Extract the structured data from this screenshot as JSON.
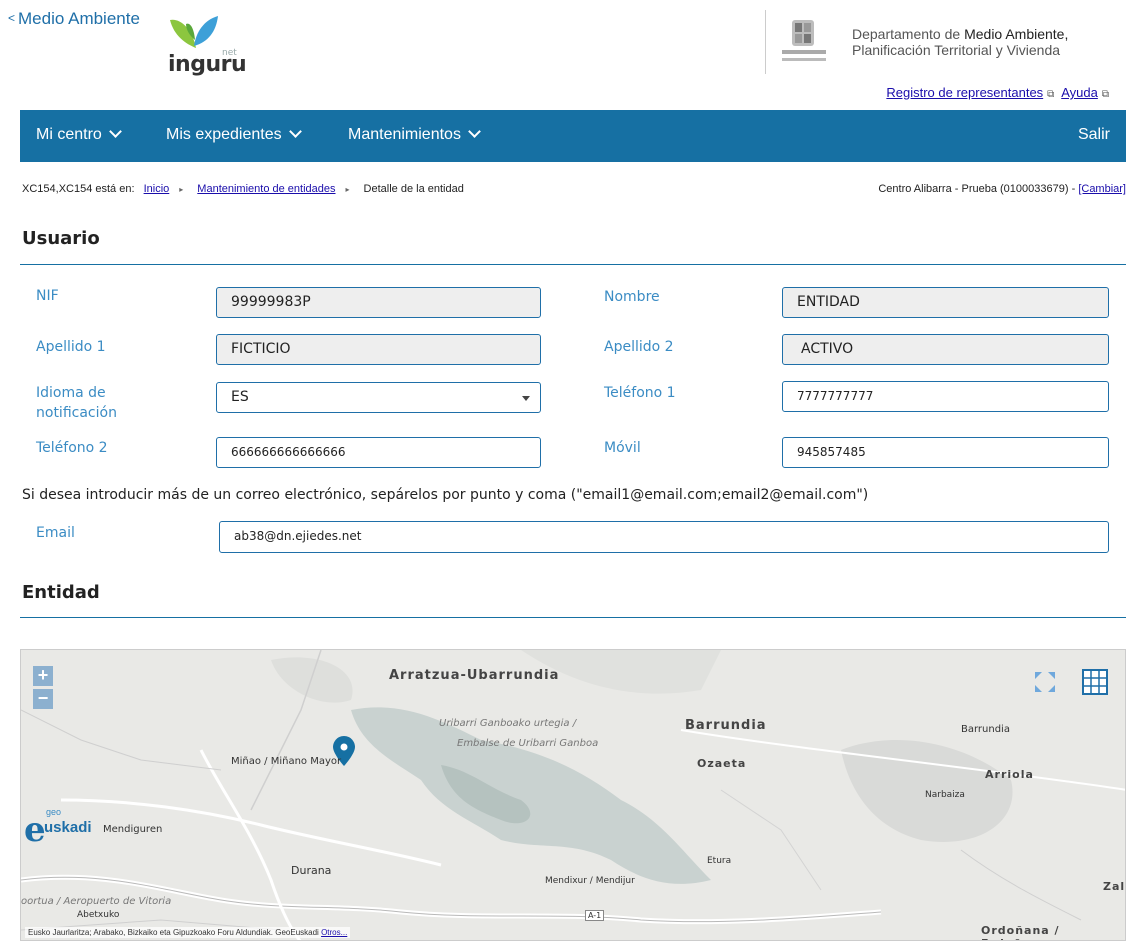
{
  "header": {
    "back_label": "Medio Ambiente",
    "logo_small": "net",
    "logo_text": "inguru",
    "dept_line1_light": "Departamento de",
    "dept_line1_strong": "Medio Ambiente,",
    "dept_line2": "Planificación Territorial y Vivienda",
    "link_registro": "Registro de representantes",
    "link_ayuda": "Ayuda"
  },
  "nav": {
    "mi_centro": "Mi centro",
    "mis_expedientes": "Mis expedientes",
    "mantenimientos": "Mantenimientos",
    "salir": "Salir"
  },
  "breadcrumb": {
    "prefix": "XC154,XC154 está en:",
    "inicio": "Inicio",
    "mantenimiento": "Mantenimiento de entidades",
    "current": "Detalle de la entidad",
    "center_text": "Centro Alibarra - Prueba (0100033679) -",
    "cambiar": "[Cambiar]"
  },
  "usuario": {
    "title": "Usuario",
    "nif_label": "NIF",
    "nif_value": "99999983P",
    "nombre_label": "Nombre",
    "nombre_value": "ENTIDAD",
    "apellido1_label": "Apellido 1",
    "apellido1_value": "FICTICIO",
    "apellido2_label": "Apellido 2",
    "apellido2_value": "ACTIVO",
    "idioma_label_1": "Idioma de",
    "idioma_label_2": "notificación",
    "idioma_value": "ES",
    "telefono1_label": "Teléfono 1",
    "telefono1_value": "7777777777",
    "telefono2_label": "Teléfono 2",
    "telefono2_value": "666666666666666",
    "movil_label": "Móvil",
    "movil_value": "945857485",
    "email_note": "Si desea introducir más de un correo electrónico, sepárelos por punto y coma (\"email1@email.com;email2@email.com\")",
    "email_label": "Email",
    "email_value": "ab38@dn.ejiedes.net"
  },
  "entidad": {
    "title": "Entidad"
  },
  "map": {
    "zoom_in": "+",
    "zoom_out": "−",
    "logo_geo": "geo",
    "logo_main": "uskadi",
    "labels": {
      "arratzua": "Arratzua-Ubarrundia",
      "unbarri": "Uribarri Ganboako urtegia /",
      "embalse": "Embalse de Uribarri Ganboa",
      "barrundia": "Barrundia",
      "barrundia2": "Barrundia",
      "ozaeta": "Ozaeta",
      "arriola": "Arriola",
      "narbaiza": "Narbaiza",
      "minano": "Miñao / Miñano Mayor",
      "mendiguren": "Mendiguren",
      "durana": "Durana",
      "etura": "Etura",
      "mendixur": "Mendixur / Mendijur",
      "aeropuerto": "oortua / Aeropuerto de Vitoria",
      "abetxuko": "Abetxuko",
      "ordonana": "Ordoñana / Erdoñana",
      "zal": "Zal",
      "a1": "A-1"
    },
    "attribution": "Eusko Jaurlaritza; Arabako, Bizkaiko eta Gipuzkoako Foru Aldundiak. GeoEuskadi",
    "attribution_link": "Otros..."
  },
  "colors": {
    "nav_blue": "#1670a3",
    "label_blue": "#3b8cc4",
    "link": "#1a0dab"
  }
}
